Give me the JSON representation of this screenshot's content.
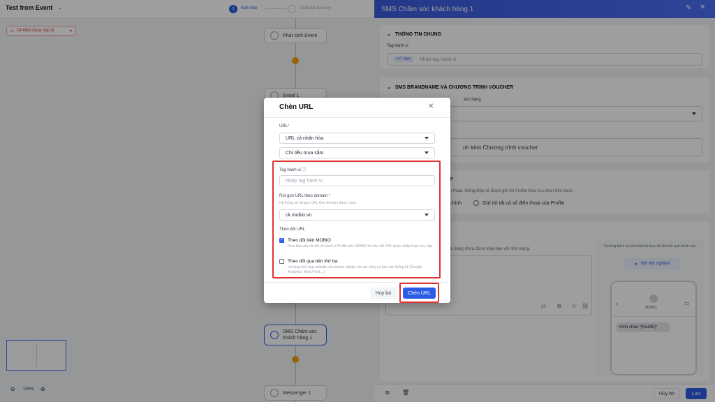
{
  "canvas": {
    "title": "Test from Event",
    "steps": [
      {
        "num": "1",
        "label": "Kịch bản"
      },
      {
        "label": "Thiết lập Journey"
      }
    ],
    "warning": "04 khối chưa hợp lệ",
    "nodes": {
      "trigger": "Phát sinh Event",
      "email": "Email 1",
      "sms": "SMS Chăm sóc khách hàng 1",
      "messenger": "Messenger 1"
    },
    "zoom": "100%"
  },
  "panel": {
    "title": "SMS Chăm sóc khách hàng 1",
    "general": {
      "heading": "THÔNG TIN CHUNG",
      "tag_label": "Tag hành vi",
      "tag_chip": "HT Yen",
      "tag_placeholder": "Nhập tag hành vi"
    },
    "sms": {
      "heading": "SMS BRANDNAME VÀ CHƯƠNG TRÌNH VOUCHER",
      "field_label": "ách hàng",
      "voucher_text": "nh kèm Chương trình voucher"
    },
    "send": {
      "heading_tail": "P",
      "desc": "n thoại, thông điệp sẽ được gửi tới Profile theo lựa chọn bên dưới.",
      "opt1": "chính",
      "opt2": "Gửi tới tất cả số điện thoại của Profile"
    },
    "content": {
      "desc": "ội dung chưa được khai báo với nhà mạng.",
      "count": "20"
    },
    "preview": {
      "desc": "Vui lòng kiểm tra trên thiết bị thực để biết kết quả chính xác.",
      "test_button": "Gửi thử nghiệm",
      "brand": "MOBIO",
      "message": "Kính chào *[NAME]*"
    },
    "footer": {
      "cancel": "Hủy bỏ",
      "save": "Lưu"
    }
  },
  "modal": {
    "title": "Chèn URL",
    "url_label": "URL",
    "url_type": "URL cá nhân hóa",
    "url_field": "Chi tiêu mua sắm",
    "tag_label": "Tag hành vi",
    "tag_placeholder": "Nhập tag hành vi",
    "domain_label": "Rút gọn URL theo domain",
    "domain_help": "Hệ thống sẽ rút gọn URL theo domain được chọn.",
    "domain_value": "ck.mobio.vn",
    "track_label": "Theo dõi URL",
    "track_mobio": {
      "label": "Theo dõi trên MOBIO",
      "desc": "Xem báo cáo chi tiết về hành vi Profile trên MOBIO khi liên kết URL được nhấp hoặc truy cập.",
      "checked": true
    },
    "track_third": {
      "label": "Theo dõi qua bên thứ ba",
      "desc": "Vui lòng tích hợp website của doanh nghiệp với các công cụ báo cáo thống kê (Google Analytics, Meta Pixel,...)",
      "checked": false
    },
    "cancel": "Hủy bỏ",
    "insert": "Chèn URL"
  },
  "colors": {
    "primary": "#2b5ce6",
    "highlight": "#e03131",
    "warning": "#e03131",
    "connector_dot": "#f59e0b"
  }
}
